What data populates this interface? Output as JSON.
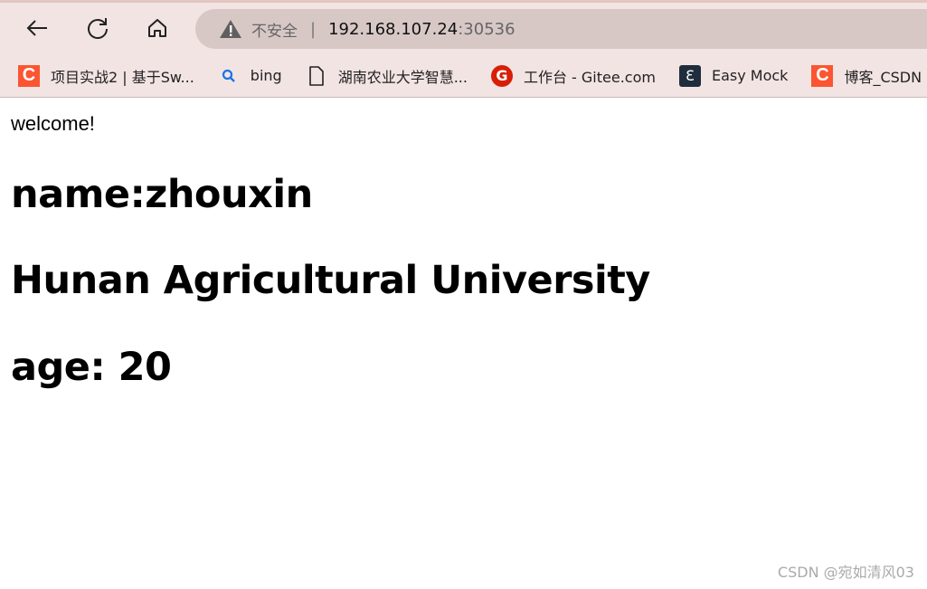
{
  "browser": {
    "security_label": "不安全",
    "url_host": "192.168.107.24",
    "url_port": ":30536",
    "bookmarks": [
      {
        "label": "项目实战2 | 基于Sw...",
        "icon": "csdn-icon"
      },
      {
        "label": "bing",
        "icon": "search-icon"
      },
      {
        "label": "湖南农业大学智慧...",
        "icon": "page-icon"
      },
      {
        "label": "工作台 - Gitee.com",
        "icon": "gitee-icon"
      },
      {
        "label": "Easy Mock",
        "icon": "easy-mock-icon"
      },
      {
        "label": "博客_CSDN",
        "icon": "csdn-icon"
      }
    ],
    "icon_glyphs": {
      "csdn": "C",
      "gitee": "G",
      "easy": "Ɛ"
    }
  },
  "page": {
    "welcome": "welcome!",
    "name": "name:zhouxin",
    "school": "Hunan Agricultural University",
    "age": "age: 20"
  },
  "watermark": "CSDN @宛如清风03"
}
